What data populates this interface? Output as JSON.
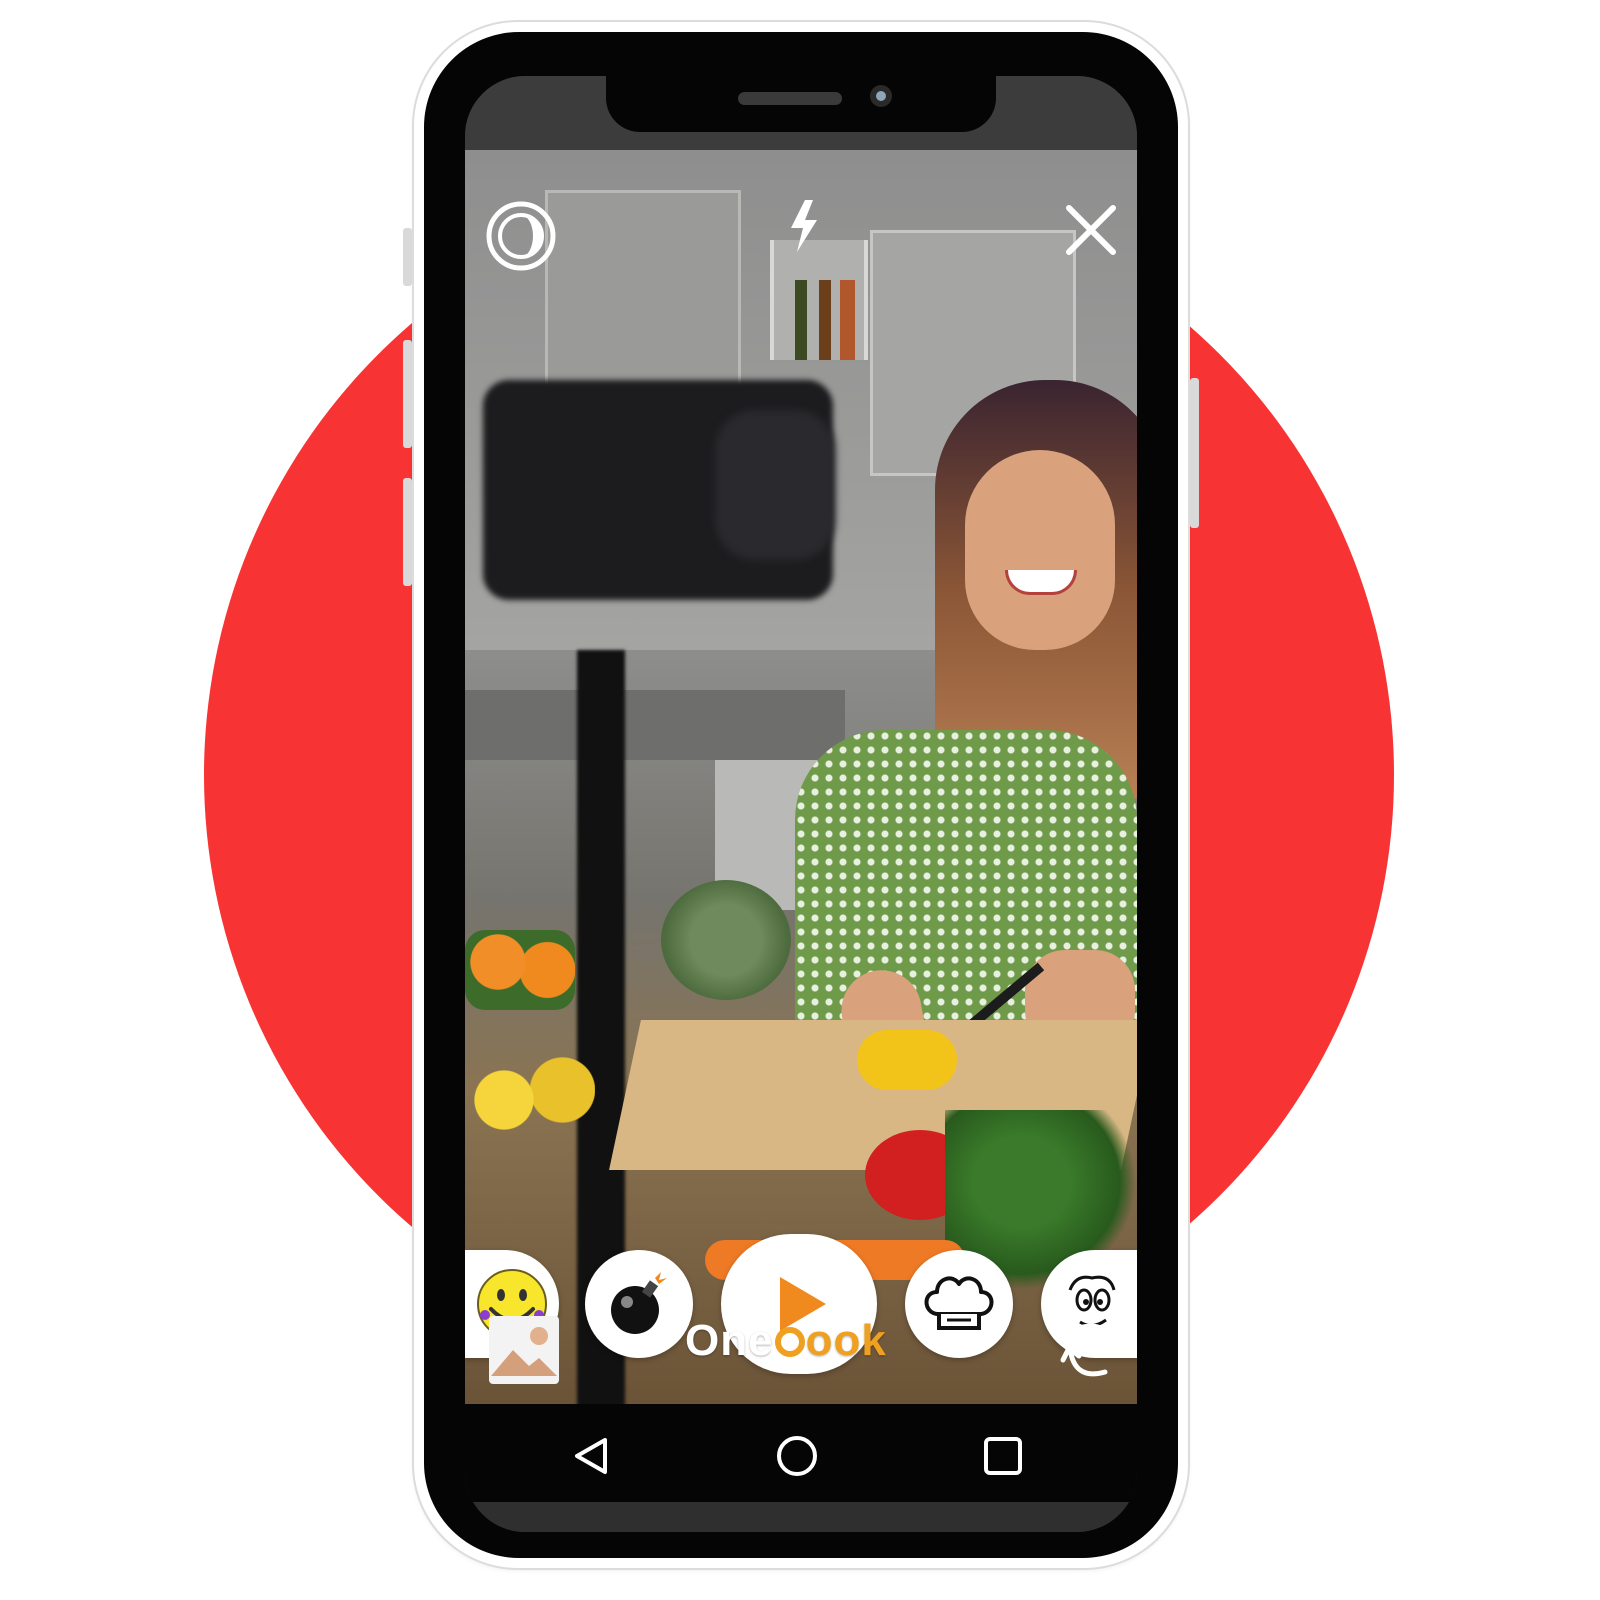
{
  "brand": {
    "prefix": "One",
    "suffix": "ook"
  },
  "colors": {
    "background_circle": "#f73333",
    "accent_orange": "#f08a1e",
    "brand_prefix": "#ffffff",
    "brand_suffix": "#f0a020"
  },
  "top_controls": {
    "timer_icon": "timer-icon",
    "flash_icon": "flash-icon",
    "close_icon": "close-icon"
  },
  "cook_row": {
    "items": [
      "smiley-sticker-icon",
      "bomb-sticker-icon",
      "record-play-icon",
      "chef-hat-icon",
      "cartoon-face-icon"
    ]
  },
  "bottom_controls": {
    "gallery_icon": "gallery-icon",
    "flip_camera_icon": "flip-camera-icon"
  },
  "nav_bar": {
    "back_icon": "back-icon",
    "home_icon": "home-icon",
    "recents_icon": "recents-icon"
  }
}
